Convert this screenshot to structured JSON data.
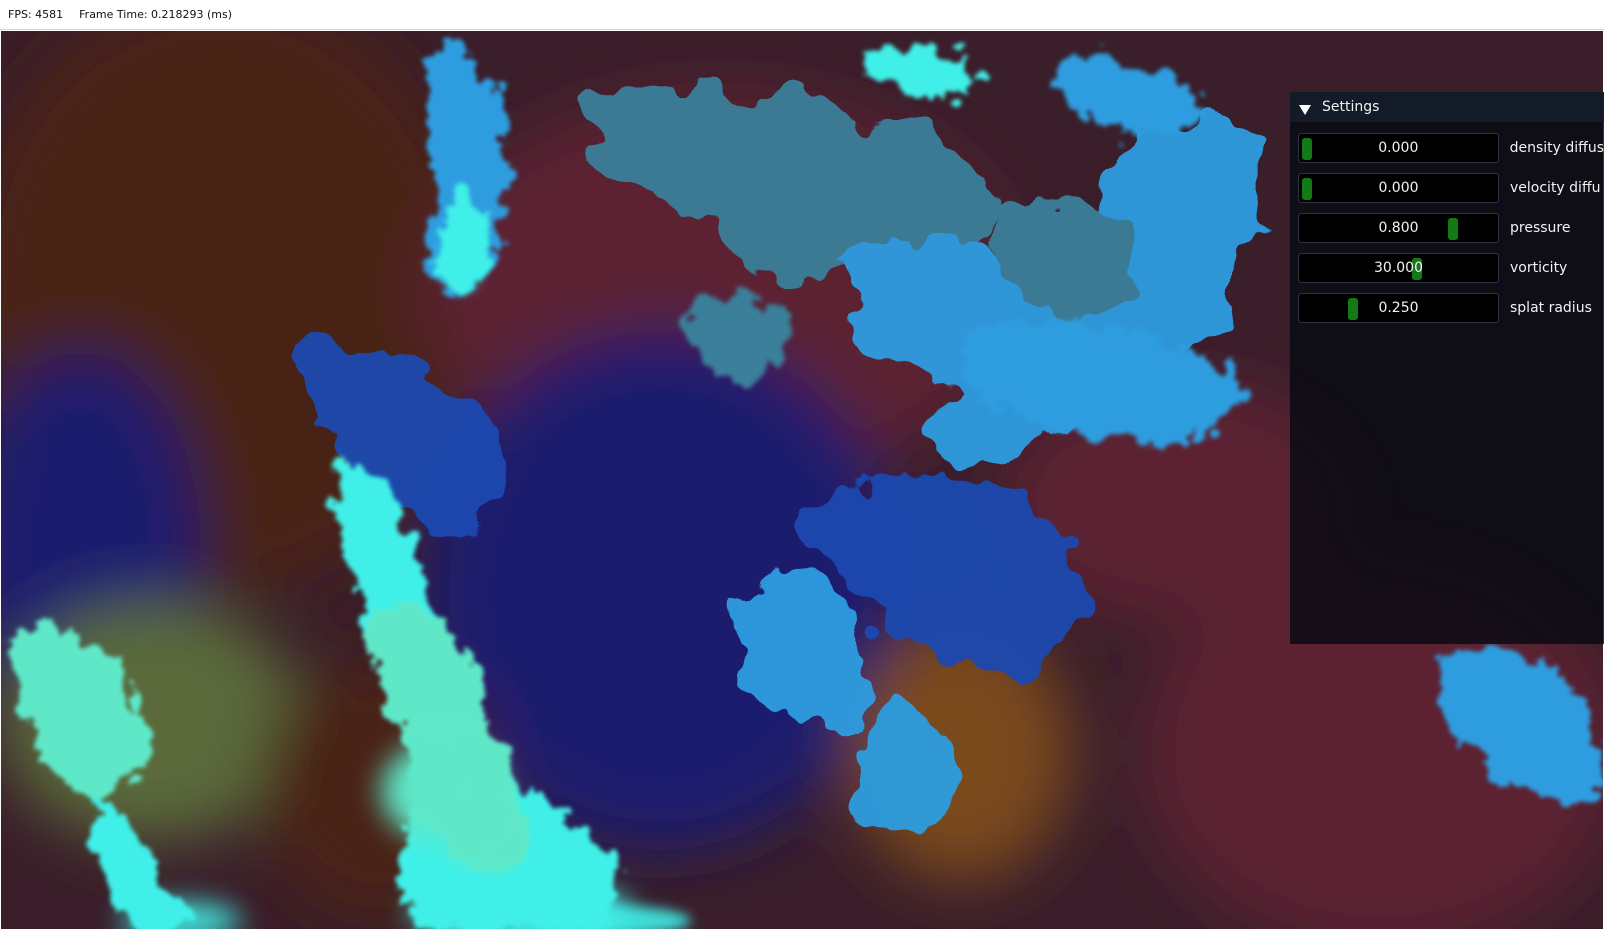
{
  "window": {
    "fps_text": "FPS: 4581",
    "frame_time_text": "Frame Time: 0.218293 (ms)"
  },
  "simulation": {
    "colors": {
      "base": "#3a1e2a",
      "brown": "#4a2418",
      "maroon": "#5c2030",
      "indigo": "#1e1c6e",
      "royal_blue": "#1a48b0",
      "sky_blue": "#2f9de0",
      "steel_teal": "#3a7f9a",
      "cyan": "#3ff0e8",
      "mint": "#5fe8c8",
      "olive": "#5a6a3a",
      "rust": "#7a4a1e"
    }
  },
  "settings": {
    "title": "Settings",
    "collapse_icon": "triangle-down-icon",
    "sliders": [
      {
        "label": "density diffus",
        "value_text": "0.000",
        "fraction": 0.0
      },
      {
        "label": "velocity diffu",
        "value_text": "0.000",
        "fraction": 0.0
      },
      {
        "label": "pressure",
        "value_text": "0.800",
        "fraction": 0.8
      },
      {
        "label": "vorticity",
        "value_text": "30.000",
        "fraction": 0.6
      },
      {
        "label": "splat radius",
        "value_text": "0.250",
        "fraction": 0.25
      }
    ],
    "grab_color": "#137a16"
  }
}
